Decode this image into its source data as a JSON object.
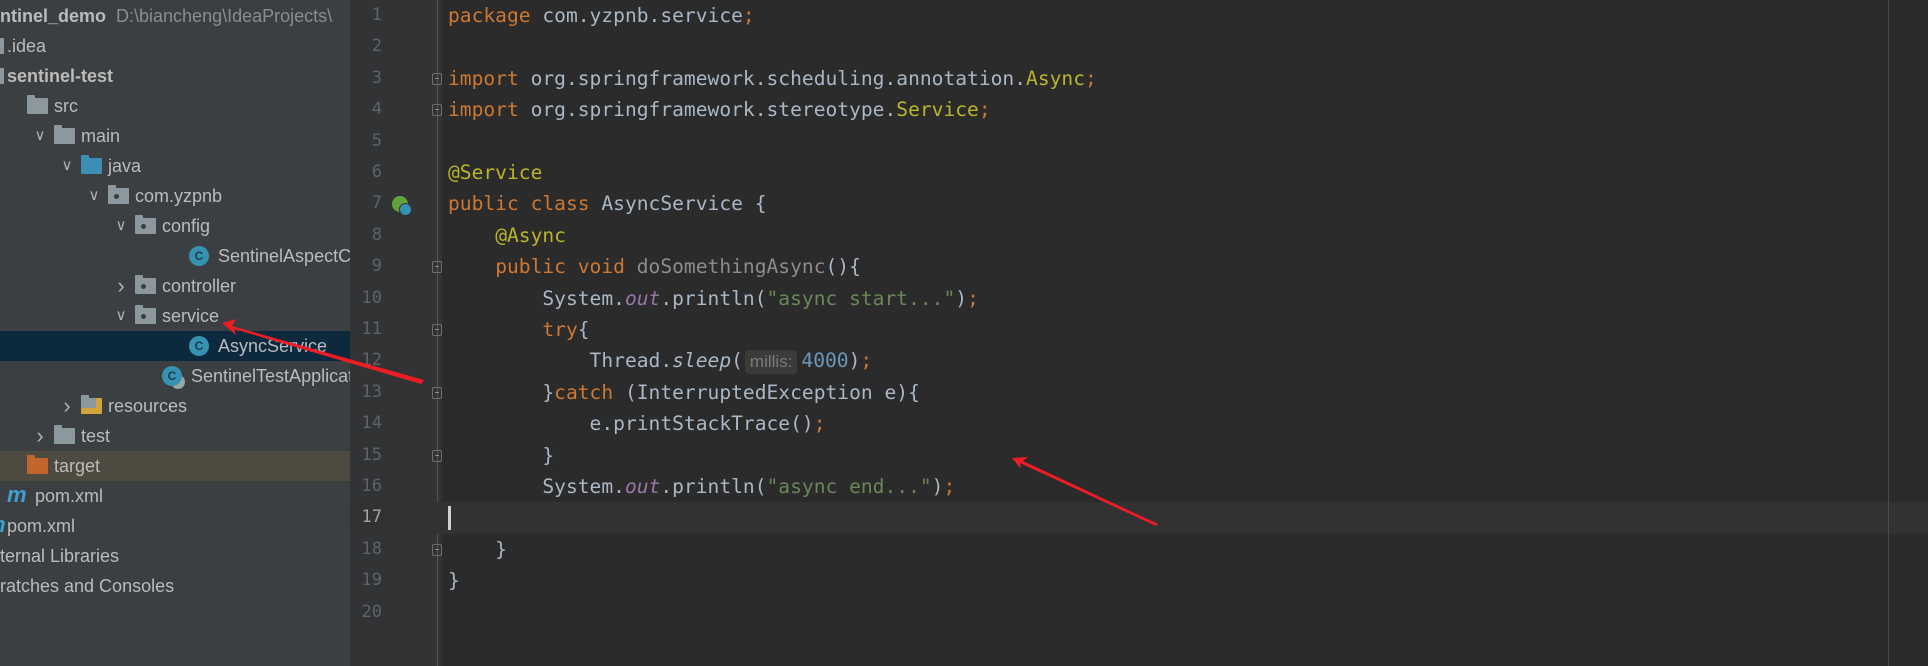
{
  "project_tree": {
    "items": [
      {
        "label": "ntinel_demo",
        "path": "D:\\biancheng\\IdeaProjects\\",
        "depth": -1,
        "icon": "none",
        "bold": true
      },
      {
        "label": ".idea",
        "depth": -1,
        "icon": "folder-icon",
        "chevron": "none"
      },
      {
        "label": "sentinel-test",
        "depth": -1,
        "icon": "module-icon",
        "bold": true,
        "chevron": "none"
      },
      {
        "label": "src",
        "depth": 0,
        "icon": "folder-icon",
        "chevron": "none"
      },
      {
        "label": "main",
        "depth": 1,
        "icon": "folder-icon",
        "chevron": "expanded"
      },
      {
        "label": "java",
        "depth": 2,
        "icon": "source-folder-icon",
        "chevron": "expanded"
      },
      {
        "label": "com.yzpnb",
        "depth": 3,
        "icon": "package-icon",
        "chevron": "expanded"
      },
      {
        "label": "config",
        "depth": 4,
        "icon": "package-icon",
        "chevron": "expanded"
      },
      {
        "label": "SentinelAspectConfig",
        "depth": 5,
        "icon": "class-icon",
        "chevron": "none"
      },
      {
        "label": "controller",
        "depth": 4,
        "icon": "package-icon",
        "chevron": "collapsed"
      },
      {
        "label": "service",
        "depth": 4,
        "icon": "package-icon",
        "chevron": "expanded"
      },
      {
        "label": "AsyncService",
        "depth": 5,
        "icon": "class-icon",
        "chevron": "none",
        "selected": true
      },
      {
        "label": "SentinelTestApplication",
        "depth": 4,
        "icon": "spring-boot-class-icon",
        "chevron": "none"
      },
      {
        "label": "resources",
        "depth": 2,
        "icon": "resources-folder-icon",
        "chevron": "collapsed"
      },
      {
        "label": "test",
        "depth": 1,
        "icon": "folder-icon",
        "chevron": "collapsed"
      },
      {
        "label": "target",
        "depth": 0,
        "icon": "excluded-folder-icon",
        "chevron": "none",
        "excluded": true
      },
      {
        "label": "pom.xml",
        "depth": 0,
        "icon": "maven-icon",
        "chevron": "none"
      },
      {
        "label": "pom.xml",
        "depth": -1,
        "icon": "maven-icon",
        "chevron": "none"
      },
      {
        "label": "ternal Libraries",
        "depth": -2,
        "icon": "none",
        "chevron": "none"
      },
      {
        "label": "ratches and Consoles",
        "depth": -2,
        "icon": "none",
        "chevron": "none"
      }
    ]
  },
  "editor": {
    "current_line": 17,
    "fold_markers": [
      3,
      4,
      9,
      11,
      13,
      15,
      18
    ],
    "gutter_icon_line": 7,
    "lines": [
      [
        {
          "t": "package ",
          "c": "kw"
        },
        {
          "t": "com.yzpnb.service"
        },
        {
          "t": ";",
          "c": "kw"
        }
      ],
      [],
      [
        {
          "t": "import ",
          "c": "kw"
        },
        {
          "t": "org.springframework.scheduling.annotation."
        },
        {
          "t": "Async",
          "c": "an"
        },
        {
          "t": ";",
          "c": "kw"
        }
      ],
      [
        {
          "t": "import ",
          "c": "kw"
        },
        {
          "t": "org.springframework.stereotype."
        },
        {
          "t": "Service",
          "c": "an"
        },
        {
          "t": ";",
          "c": "kw"
        }
      ],
      [],
      [
        {
          "t": "@Service",
          "c": "an"
        }
      ],
      [
        {
          "t": "public class ",
          "c": "kw"
        },
        {
          "t": "AsyncService {"
        }
      ],
      [
        {
          "t": "    "
        },
        {
          "t": "@Async",
          "c": "an"
        }
      ],
      [
        {
          "t": "    "
        },
        {
          "t": "public void ",
          "c": "kw"
        },
        {
          "t": "doSomethingAsync",
          "c": "un"
        },
        {
          "t": "(){"
        }
      ],
      [
        {
          "t": "        System."
        },
        {
          "t": "out",
          "c": "fi"
        },
        {
          "t": ".println("
        },
        {
          "t": "\"async start...\"",
          "c": "st"
        },
        {
          "t": ")"
        },
        {
          "t": ";",
          "c": "kw"
        }
      ],
      [
        {
          "t": "        "
        },
        {
          "t": "try",
          "c": "kw"
        },
        {
          "t": "{"
        }
      ],
      [
        {
          "t": "            Thread."
        },
        {
          "t": "sleep",
          "c": "it"
        },
        {
          "t": "("
        },
        {
          "t": "millis:",
          "c": "hint"
        },
        {
          "t": "4000",
          "c": "nu"
        },
        {
          "t": ")"
        },
        {
          "t": ";",
          "c": "kw"
        }
      ],
      [
        {
          "t": "        }"
        },
        {
          "t": "catch ",
          "c": "kw"
        },
        {
          "t": "(InterruptedException e){"
        }
      ],
      [
        {
          "t": "            e.printStackTrace()"
        },
        {
          "t": ";",
          "c": "kw"
        }
      ],
      [
        {
          "t": "        }"
        }
      ],
      [
        {
          "t": "        System."
        },
        {
          "t": "out",
          "c": "fi"
        },
        {
          "t": ".println("
        },
        {
          "t": "\"async end...\"",
          "c": "st"
        },
        {
          "t": ")"
        },
        {
          "t": ";",
          "c": "kw"
        }
      ],
      [],
      [
        {
          "t": "    }"
        }
      ],
      [
        {
          "t": "}"
        }
      ],
      []
    ]
  },
  "annotation_color": "#ee1c25"
}
